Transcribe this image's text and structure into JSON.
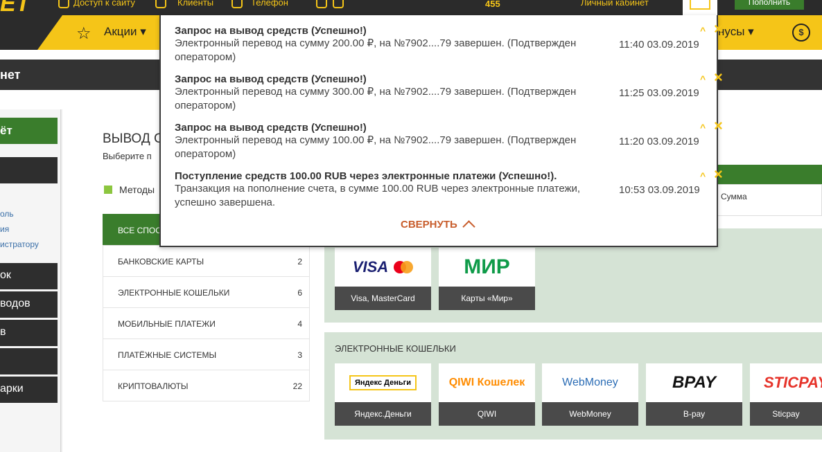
{
  "topbar": {
    "logo": "ЕТ",
    "item1": "Доступ к сайту",
    "item2": "Клиенты",
    "item3": "Телефон",
    "counter": "455",
    "cabinet": "Личный кабинет",
    "topup": "Пополнить"
  },
  "nav": {
    "promo": "Акции",
    "bonus": "нусы"
  },
  "strip": {
    "title": "нет"
  },
  "sidebar": {
    "green": "ёт",
    "items": [
      "ок",
      "водов",
      "в",
      "арки"
    ],
    "links": [
      "оль",
      "ия",
      "истратору"
    ]
  },
  "main": {
    "heading": "ВЫВОД С",
    "subheading": "Выберите п",
    "methods_label": "Методы"
  },
  "categories": [
    {
      "label": "ВСЕ СПОС",
      "count": ""
    },
    {
      "label": "БАНКОВСКИЕ КАРТЫ",
      "count": "2"
    },
    {
      "label": "ЭЛЕКТРОННЫЕ КОШЕЛЬКИ",
      "count": "6"
    },
    {
      "label": "МОБИЛЬНЫЕ ПЛАТЕЖИ",
      "count": "4"
    },
    {
      "label": "ПЛАТЁЖНЫЕ СИСТЕМЫ",
      "count": "3"
    },
    {
      "label": "КРИПТОВАЛЮТЫ",
      "count": "22"
    }
  ],
  "sum_label": "Сумма",
  "cards": {
    "visa": "Visa, MasterCard",
    "mir": "Карты «Мир»",
    "mir_logo": "МИР",
    "visa_logo": "VISA"
  },
  "wallets": {
    "title": "ЭЛЕКТРОННЫЕ КОШЕЛЬКИ",
    "items": [
      "Яндекс.Деньги",
      "QIWI",
      "WebMoney",
      "B-pay",
      "Sticpay"
    ],
    "logos": [
      "Яндекс Деньги",
      "QIWI Кошелек",
      "WebMoney",
      "BPAY",
      "STICPAY"
    ]
  },
  "notifications": [
    {
      "title": "Запрос на вывод средств (Успешно!)",
      "body": "Электронный перевод на сумму 200.00 ₽, на №7902....79 завершен. (Подтвержден оператором)",
      "time": "11:40 03.09.2019"
    },
    {
      "title": "Запрос на вывод средств (Успешно!)",
      "body": "Электронный перевод на сумму 300.00 ₽, на №7902....79 завершен. (Подтвержден оператором)",
      "time": "11:25 03.09.2019"
    },
    {
      "title": "Запрос на вывод средств (Успешно!)",
      "body": "Электронный перевод на сумму 100.00 ₽, на №7902....79 завершен. (Подтвержден оператором)",
      "time": "11:20 03.09.2019"
    },
    {
      "title": "Поступление средств 100.00 RUB через электронные платежи (Успешно!).",
      "body": "Транзакция на пополнение счета, в сумме 100.00 RUB через электронные платежи, успешно завершена.",
      "time": "10:53 03.09.2019"
    }
  ],
  "collapse_label": "СВЕРНУТЬ",
  "colors": {
    "brand_yellow": "#f5c518",
    "brand_green": "#3a7d2c",
    "accent_orange": "#c85d2c"
  }
}
